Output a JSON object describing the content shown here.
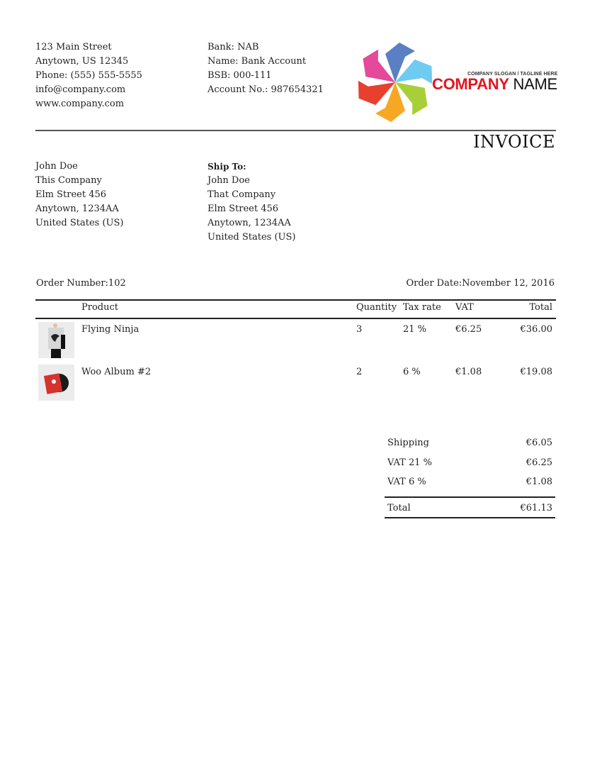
{
  "company": {
    "address_lines": [
      "123 Main Street",
      "Anytown, US 12345",
      "Phone: (555) 555-5555",
      "info@company.com",
      "www.company.com"
    ]
  },
  "bank": {
    "lines": [
      "Bank: NAB",
      "Name: Bank Account",
      "BSB: 000-111",
      "Account No.: 987654321"
    ]
  },
  "logo": {
    "slogan": "COMPANY SLOGAN / TAGLINE HERE",
    "name_part1": "COMPANY",
    "name_part2": "NAME",
    "colors": [
      "#5b7fc4",
      "#6fcbef",
      "#a9cf38",
      "#f7a823",
      "#e8402f",
      "#e4499a"
    ],
    "name_color": "#e3161f"
  },
  "document": {
    "title": "INVOICE"
  },
  "bill_to": {
    "lines": [
      "John Doe",
      "This Company",
      "Elm Street 456",
      "Anytown, 1234AA",
      "United States (US)"
    ]
  },
  "ship_to": {
    "label": "Ship To:",
    "lines": [
      "John Doe",
      "That Company",
      "Elm Street 456",
      "Anytown, 1234AA",
      "United States (US)"
    ]
  },
  "order": {
    "number_label": "Order Number:",
    "number": "102",
    "date_label": "Order Date:",
    "date": "November 12, 2016"
  },
  "table": {
    "headers": {
      "product": "Product",
      "quantity": "Quantity",
      "tax_rate": "Tax rate",
      "vat": "VAT",
      "total": "Total"
    },
    "rows": [
      {
        "product": "Flying Ninja",
        "quantity": "3",
        "tax_rate": "21 %",
        "vat": "€6.25",
        "total": "€36.00",
        "thumb": "poster-thumbnail"
      },
      {
        "product": "Woo Album #2",
        "quantity": "2",
        "tax_rate": "6 %",
        "vat": "€1.08",
        "total": "€19.08",
        "thumb": "album-thumbnail"
      }
    ]
  },
  "totals": {
    "shipping_label": "Shipping",
    "shipping": "€6.05",
    "vat21_label": "VAT 21 %",
    "vat21": "€6.25",
    "vat6_label": "VAT 6 %",
    "vat6": "€1.08",
    "total_label": "Total",
    "total": "€61.13"
  }
}
